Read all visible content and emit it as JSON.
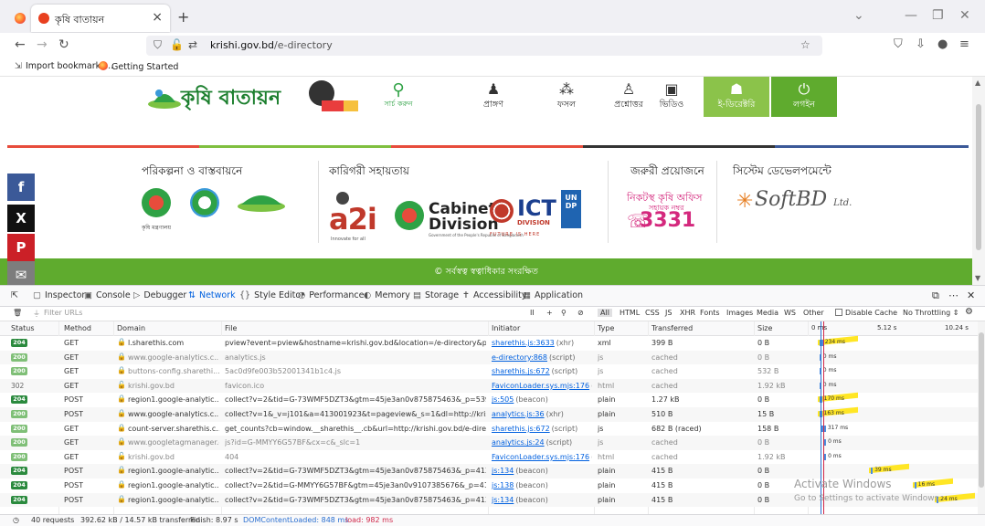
{
  "browser": {
    "tab_title": "কৃষি বাতায়ন",
    "tab_close": "×",
    "new_tab": "+",
    "url_domain": "krishi.gov.bd",
    "url_path": "/e-directory",
    "bookmarks": [
      "Import bookmarks...",
      "Getting Started"
    ]
  },
  "site": {
    "logo_text": "কৃষি বাতায়ন",
    "nav": [
      {
        "label": "সার্চ করুন",
        "icon": "search-icon"
      },
      {
        "label": "প্রাঙ্গণ",
        "icon": "farmer-icon"
      },
      {
        "label": "ফসল",
        "icon": "crop-icon"
      },
      {
        "label": "প্রশ্নোত্তর",
        "icon": "qa-icon"
      },
      {
        "label": "ভিডিও",
        "icon": "video-icon"
      },
      {
        "label": "ই-ডিরেক্টরি",
        "icon": "directory-icon"
      },
      {
        "label": "লগইন",
        "icon": "power-icon"
      }
    ],
    "partners": {
      "planning_heading": "পরিকল্পনা ও বাস্তবায়নে",
      "ministry_caption": "কৃষি মন্ত্রণালয়",
      "tech_heading": "কারিগরী সহায়তায়",
      "a2i": "a2i",
      "a2i_tagline": "Innovate for all",
      "cabinet_l1": "Cabinet",
      "cabinet_l2": "Division",
      "cabinet_l3": "Government of the People's Republic of Bangladesh",
      "ict_t": "ICT",
      "ict_d": "DIVISION",
      "ict_f": "FUTURE IS HERE",
      "undp": "UN DP",
      "urgent_heading": "জরুরী প্রয়োজনে",
      "hotline_caption": "নিকটস্থ কৃষি অফিস",
      "hotline_sub": "সহায়ক নম্বর",
      "hotline_number": "3331",
      "dev_heading": "সিস্টেম ডেভেলপমেন্টে",
      "softbd": "SoftBD",
      "softbd_suffix": "Ltd."
    },
    "footer_text": "© সর্বস্বত্ব স্বত্বাধিকার সংরক্ষিত",
    "social": [
      "f",
      "X",
      "P",
      "✉"
    ]
  },
  "devtools": {
    "tabs": [
      "Inspector",
      "Console",
      "Debugger",
      "Network",
      "Style Editor",
      "Performance",
      "Memory",
      "Storage",
      "Accessibility",
      "Application"
    ],
    "active_tab": "Network",
    "filter_placeholder": "Filter URLs",
    "type_filters": [
      "All",
      "HTML",
      "CSS",
      "JS",
      "XHR",
      "Fonts",
      "Images",
      "Media",
      "WS",
      "Other"
    ],
    "disable_cache": "Disable Cache",
    "throttling": "No Throttling ⇕",
    "columns": [
      "Status",
      "Method",
      "Domain",
      "File",
      "Initiator",
      "Type",
      "Transferred",
      "Size"
    ],
    "waterfall_ticks": [
      "0 ms",
      "5.12 s",
      "10.24 s"
    ],
    "rows": [
      {
        "status": "204",
        "method": "GET",
        "domain": "l.sharethis.com",
        "file": "pview?event=pview&hostname=krishi.gov.bd&location=/e-directory&product=sticky",
        "init": "sharethis.js:3633",
        "init_meta": "(xhr)",
        "type": "xml",
        "transferred": "399 B",
        "size": "0 B",
        "wf": "234 ms",
        "wf_pos": 0.05,
        "hl": true
      },
      {
        "status": "200",
        "method": "GET",
        "domain": "www.google-analytics.c...",
        "file": "analytics.js",
        "init": "e-directory:868",
        "init_meta": "(script)",
        "type": "js",
        "transferred": "cached",
        "size": "0 B",
        "wf": "0 ms",
        "wf_pos": 0.05,
        "hl": false
      },
      {
        "status": "200",
        "method": "GET",
        "domain": "buttons-config.sharethi...",
        "file": "5ac0d9fe003b52001341b1c4.js",
        "init": "sharethis.js:672",
        "init_meta": "(script)",
        "type": "js",
        "transferred": "cached",
        "size": "532 B",
        "wf": "0 ms",
        "wf_pos": 0.05,
        "hl": false
      },
      {
        "status": "302",
        "method": "GET",
        "domain": "krishi.gov.bd",
        "file": "favicon.ico",
        "init": "FaviconLoader.sys.mjs:176",
        "init_meta": "(img)",
        "type": "html",
        "transferred": "cached",
        "size": "1.92 kB",
        "wf": "0 ms",
        "wf_pos": 0.05,
        "hl": false
      },
      {
        "status": "204",
        "method": "POST",
        "domain": "region1.google-analytic...",
        "file": "collect?v=2&tid=G-73WMF5DZT3&gtm=45je3an0v875875463&_p=539471229&cid=1",
        "init": "js:505",
        "init_meta": "(beacon)",
        "type": "plain",
        "transferred": "1.27 kB",
        "size": "0 B",
        "wf": "170 ms",
        "wf_pos": 0.05,
        "hl": true
      },
      {
        "status": "200",
        "method": "POST",
        "domain": "www.google-analytics.c...",
        "file": "collect?v=1&_v=j101&a=413001923&t=pageview&_s=1&dl=http://krishi.gov.bd/e-d",
        "init": "analytics.js:36",
        "init_meta": "(xhr)",
        "type": "plain",
        "transferred": "510 B",
        "size": "15 B",
        "wf": "163 ms",
        "wf_pos": 0.05,
        "hl": true
      },
      {
        "status": "200",
        "method": "GET",
        "domain": "count-server.sharethis.c...",
        "file": "get_counts?cb=window.__sharethis__.cb&url=http://krishi.gov.bd/e-directory",
        "init": "sharethis.js:672",
        "init_meta": "(script)",
        "type": "js",
        "transferred": "682 B (raced)",
        "size": "158 B",
        "wf": "317 ms",
        "wf_pos": 0.06,
        "hl": false
      },
      {
        "status": "200",
        "method": "GET",
        "domain": "www.googletagmanager.c...",
        "file": "js?id=G-MMYY6G57BF&cx=c&_slc=1",
        "init": "analytics.js:24",
        "init_meta": "(script)",
        "type": "js",
        "transferred": "cached",
        "size": "0 B",
        "wf": "0 ms",
        "wf_pos": 0.08,
        "hl": false
      },
      {
        "status": "200",
        "method": "GET",
        "domain": "krishi.gov.bd",
        "file": "404",
        "init": "FaviconLoader.sys.mjs:176",
        "init_meta": "(img)",
        "type": "html",
        "transferred": "cached",
        "size": "1.92 kB",
        "wf": "0 ms",
        "wf_pos": 0.08,
        "hl": false
      },
      {
        "status": "204",
        "method": "POST",
        "domain": "region1.google-analytic...",
        "file": "collect?v=2&tid=G-73WMF5DZT3&gtm=45je3an0v875875463&_p=413001923&cid=1",
        "init": "js:134",
        "init_meta": "(beacon)",
        "type": "plain",
        "transferred": "415 B",
        "size": "0 B",
        "wf": "39 ms",
        "wf_pos": 0.37,
        "hl": true
      },
      {
        "status": "204",
        "method": "POST",
        "domain": "region1.google-analytic...",
        "file": "collect?v=2&tid=G-MMYY6G57BF&gtm=45je3an0v9107385676&_p=413001923&ul=en",
        "init": "js:138",
        "init_meta": "(beacon)",
        "type": "plain",
        "transferred": "415 B",
        "size": "0 B",
        "wf": "16 ms",
        "wf_pos": 0.64,
        "hl": true
      },
      {
        "status": "204",
        "method": "POST",
        "domain": "region1.google-analytic...",
        "file": "collect?v=2&tid=G-73WMF5DZT3&gtm=45je3an0v875875463&_p=413001923&cid=1",
        "init": "js:134",
        "init_meta": "(beacon)",
        "type": "plain",
        "transferred": "415 B",
        "size": "0 B",
        "wf": "24 ms",
        "wf_pos": 0.78,
        "hl": true
      }
    ],
    "watermark": "Activate Windows",
    "watermark_sub": "Go to Settings to activate Windows.",
    "status": {
      "requests": "40 requests",
      "transferred": "392.62 kB / 14.57 kB transferred",
      "finish": "Finish: 8.97 s",
      "dcl": "DOMContentLoaded: 848 ms",
      "load": "load: 982 ms"
    }
  }
}
